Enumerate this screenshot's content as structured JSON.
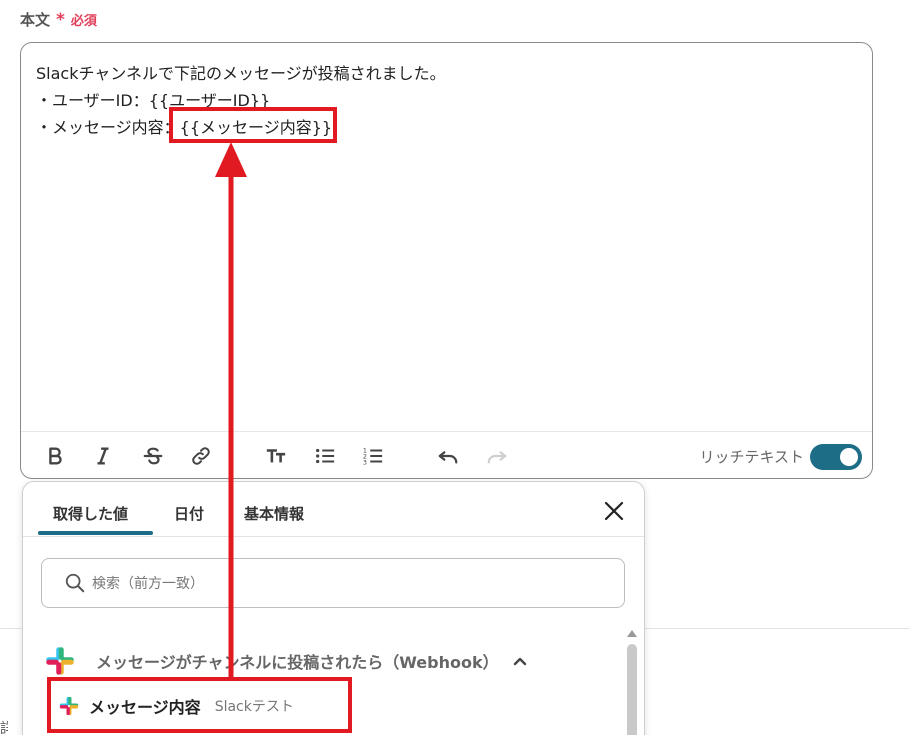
{
  "field": {
    "label": "本文",
    "asterisk": "*",
    "required": "必須"
  },
  "editor": {
    "lines": [
      "Slackチャンネルで下記のメッセージが投稿されました。",
      "・ユーザーID：{{ユーザーID}}",
      "・メッセージ内容：{{メッセージ内容}}"
    ],
    "rich_text_label": "リッチテキスト",
    "rich_text_enabled": true
  },
  "toolbar": {
    "icons": [
      "bold-icon",
      "italic-icon",
      "strikethrough-icon",
      "link-icon",
      "text-size-icon",
      "bullet-list-icon",
      "numbered-list-icon",
      "undo-icon",
      "redo-icon"
    ]
  },
  "picker": {
    "tabs": [
      {
        "label": "取得した値",
        "active": true
      },
      {
        "label": "日付",
        "active": false
      },
      {
        "label": "基本情報",
        "active": false
      }
    ],
    "search": {
      "placeholder": "検索（前方一致）"
    },
    "group": {
      "title": "メッセージがチャンネルに投稿されたら（Webhook）"
    },
    "item": {
      "name": "メッセージ内容",
      "sub": "Slackテスト"
    }
  },
  "edge_text": "詳",
  "colors": {
    "accent": "#1e6d86",
    "required": "#e0405a",
    "highlight": "#e11a22"
  }
}
